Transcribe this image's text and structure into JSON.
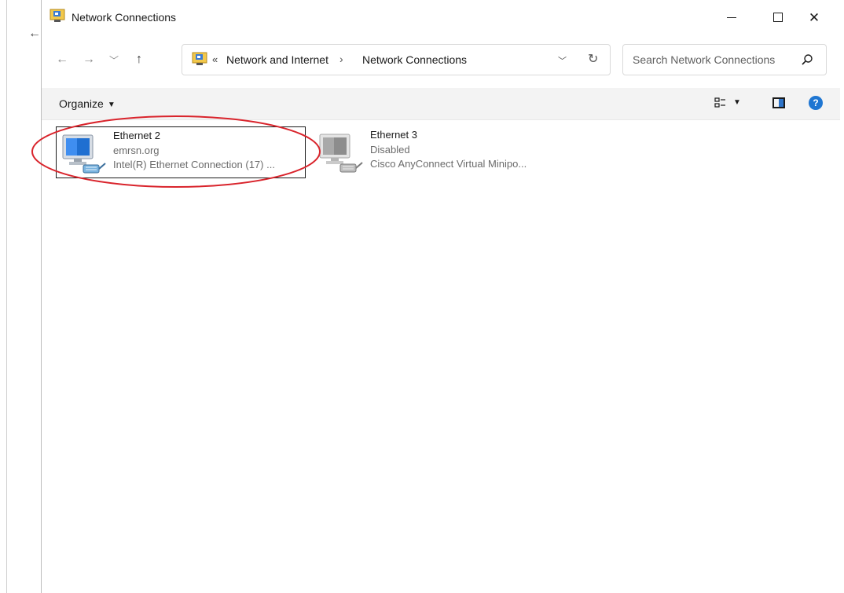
{
  "window": {
    "title": "Network Connections",
    "controls": {
      "minimize": "minimize",
      "maximize": "maximize",
      "close": "close"
    }
  },
  "navigation": {
    "back_icon": "back-arrow-icon",
    "forward_icon": "forward-arrow-icon",
    "recent_icon": "chevron-down-icon",
    "up_icon": "up-arrow-icon"
  },
  "address_bar": {
    "overflow": "«",
    "crumbs": [
      "Network and Internet",
      "Network Connections"
    ],
    "separator": "›"
  },
  "search": {
    "placeholder": "Search Network Connections"
  },
  "command_bar": {
    "organize_label": "Organize"
  },
  "connections": [
    {
      "name": "Ethernet 2",
      "status": "emrsn.org",
      "device": "Intel(R) Ethernet Connection (17) ...",
      "enabled": true,
      "selected": true
    },
    {
      "name": "Ethernet 3",
      "status": "Disabled",
      "device": "Cisco AnyConnect Virtual Minipo...",
      "enabled": false,
      "selected": false
    }
  ],
  "colors": {
    "annotation": "#d9242c",
    "accent": "#1f76d2"
  }
}
